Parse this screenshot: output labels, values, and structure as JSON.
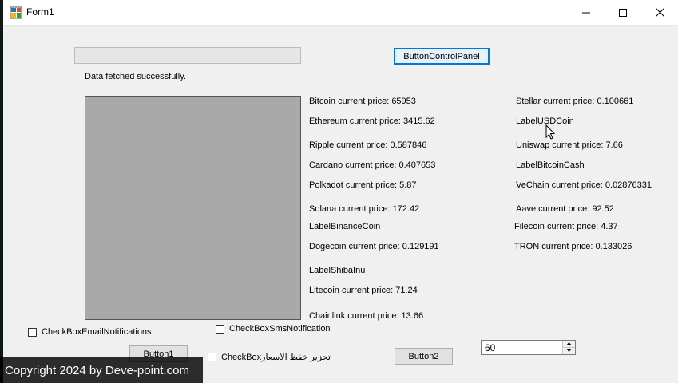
{
  "window": {
    "title": "Form1"
  },
  "status": {
    "message": "Data fetched successfully."
  },
  "progress": {
    "value": 0
  },
  "buttons": {
    "control_panel": "ButtonControlPanel",
    "button1": "Button1",
    "button2": "Button2"
  },
  "prices_left": [
    "Bitcoin current price: 65953",
    "Ethereum current price: 3415.62",
    "Ripple current price: 0.587846",
    "Cardano current price: 0.407653",
    "Polkadot current price: 5.87",
    "Solana current price: 172.42",
    "LabelBinanceCoin",
    "Dogecoin current price: 0.129191",
    "LabelShibaInu",
    "Litecoin current price: 71.24",
    "Chainlink current price: 13.66"
  ],
  "prices_right": [
    "Stellar current price: 0.100661",
    "LabelUSDCoin",
    "Uniswap current price: 7.66",
    "LabelBitcoinCash",
    "VeChain current price: 0.02876331",
    "Aave current price: 92.52",
    "Filecoin current price: 4.37",
    "TRON current price: 0.133026"
  ],
  "checkboxes": {
    "email": "CheckBoxEmailNotifications",
    "sms": "CheckBoxSmsNotification",
    "price_drop": "CheckBoxتحزير خفظ الاسعار"
  },
  "numeric": {
    "value": "60"
  },
  "watermark": "Copyright 2024 by Deve-point.com"
}
